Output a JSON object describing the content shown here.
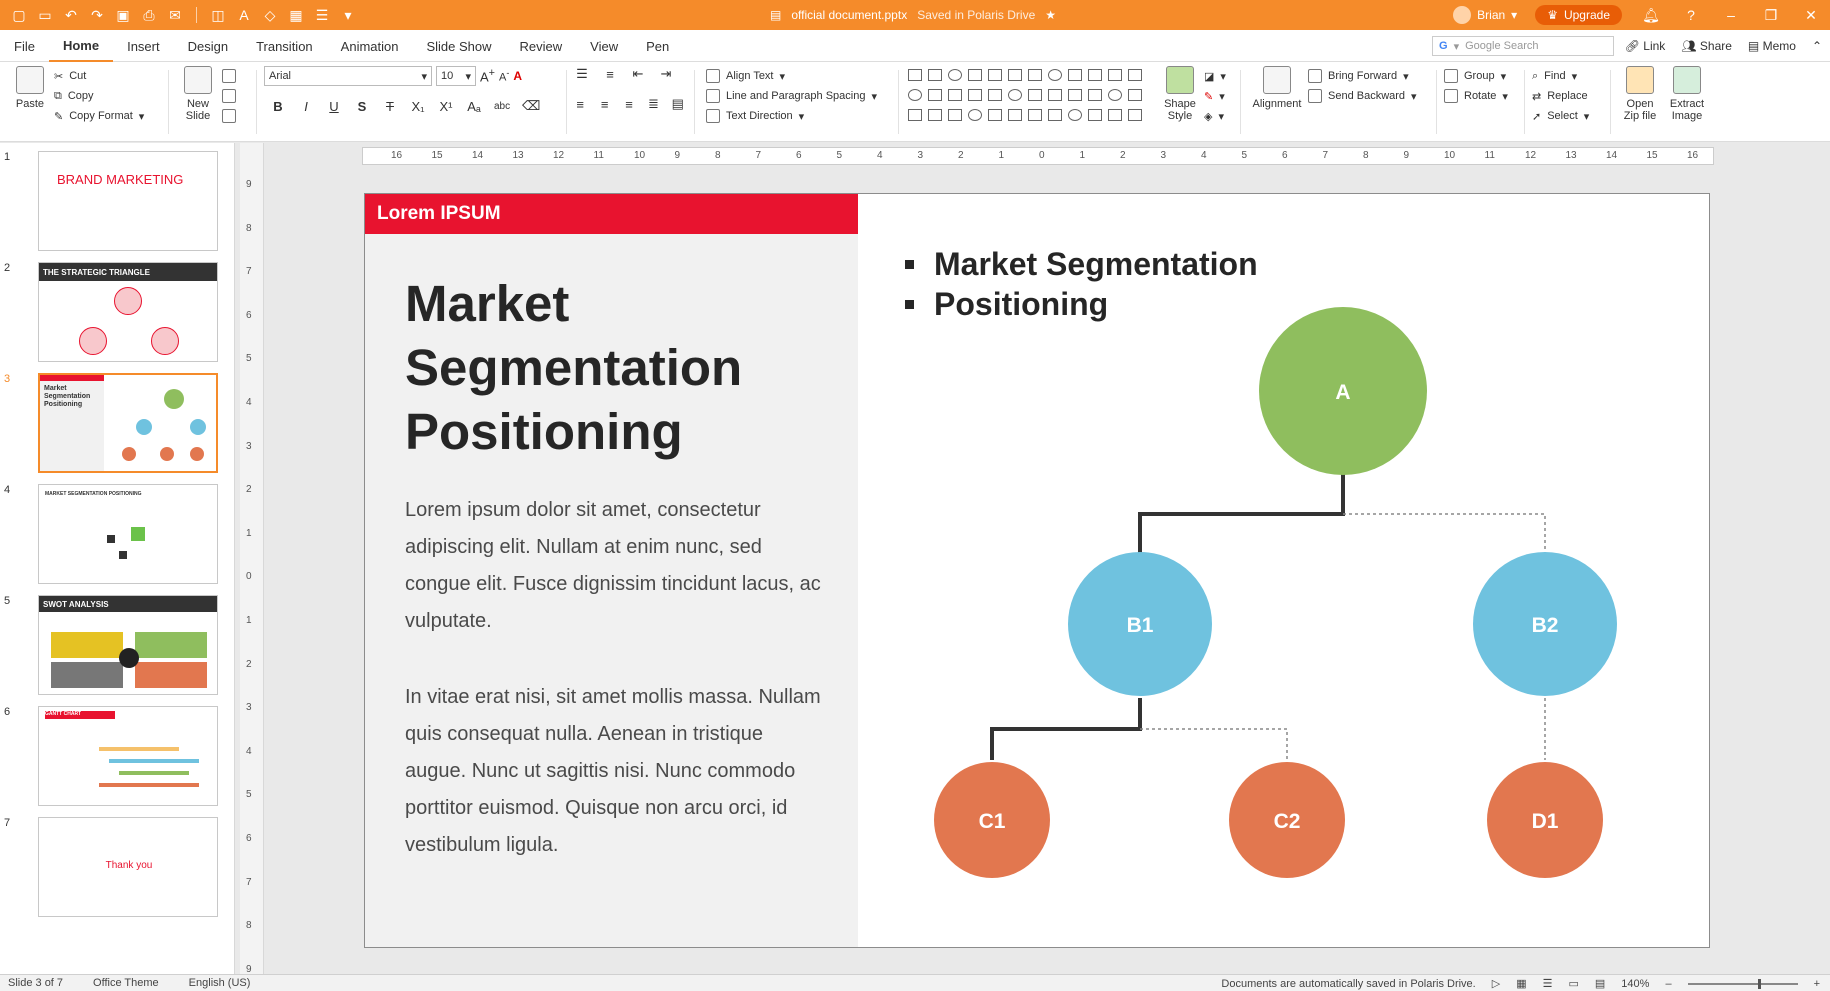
{
  "titlebar": {
    "doc_name": "official document.pptx",
    "saved_status": "Saved in Polaris Drive",
    "user_name": "Brian",
    "upgrade_label": "Upgrade"
  },
  "menu": {
    "items": [
      "File",
      "Home",
      "Insert",
      "Design",
      "Transition",
      "Animation",
      "Slide Show",
      "Review",
      "View",
      "Pen"
    ],
    "active": "Home",
    "search_placeholder": "Google Search",
    "right": [
      "Link",
      "Share",
      "Memo"
    ]
  },
  "ribbon": {
    "paste": "Paste",
    "cut": "Cut",
    "copy": "Copy",
    "copy_format": "Copy Format",
    "new_slide": "New Slide",
    "font_name": "Arial",
    "font_size": "10",
    "align_text": "Align Text",
    "line_spacing": "Line and Paragraph Spacing",
    "text_direction": "Text Direction",
    "shape_style": "Shape Style",
    "alignment": "Alignment",
    "bring_forward": "Bring Forward",
    "send_backward": "Send Backward",
    "group": "Group",
    "rotate": "Rotate",
    "find": "Find",
    "replace": "Replace",
    "select": "Select",
    "open_zip": "Open Zip file",
    "extract_image": "Extract Image"
  },
  "thumbnails": [
    {
      "num": "1",
      "title": "BRAND MARKETING"
    },
    {
      "num": "2",
      "title": "THE STRATEGIC TRIANGLE"
    },
    {
      "num": "3",
      "title": "Market Segmentation Positioning"
    },
    {
      "num": "4",
      "title": "MARKET SEGMENTATION POSITIONING"
    },
    {
      "num": "5",
      "title": "SWOT ANALYSIS"
    },
    {
      "num": "6",
      "title": "GANTT CHART"
    },
    {
      "num": "7",
      "title": "Thank you"
    }
  ],
  "slide": {
    "header": "Lorem IPSUM",
    "title_lines": [
      "Market",
      "Segmentation",
      "Positioning"
    ],
    "body1": "Lorem ipsum dolor sit amet, consectetur adipiscing elit. Nullam at enim nunc, sed congue elit. Fusce dignissim tincidunt lacus, ac vulputate.",
    "body2": "In vitae erat nisi, sit amet mollis massa. Nullam quis consequat nulla. Aenean in tristique augue. Nunc ut sagittis nisi. Nunc commodo porttitor euismod. Quisque non arcu orci, id vestibulum ligula.",
    "bullets": [
      "Market Segmentation",
      "Positioning"
    ],
    "nodes": {
      "a": "A",
      "b1": "B1",
      "b2": "B2",
      "c1": "C1",
      "c2": "C2",
      "d1": "D1"
    },
    "colors": {
      "green": "#8fbe5e",
      "blue": "#6fc2df",
      "orange": "#e2774f",
      "red": "#e8132f"
    }
  },
  "status": {
    "slide": "Slide 3 of 7",
    "theme": "Office Theme",
    "language": "English (US)",
    "autosave": "Documents are automatically saved in Polaris Drive.",
    "zoom": "140%"
  },
  "rulers": {
    "horizontal": [
      "16",
      "15",
      "14",
      "13",
      "12",
      "11",
      "10",
      "9",
      "8",
      "7",
      "6",
      "5",
      "4",
      "3",
      "2",
      "1",
      "0",
      "1",
      "2",
      "3",
      "4",
      "5",
      "6",
      "7",
      "8",
      "9",
      "10",
      "11",
      "12",
      "13",
      "14",
      "15",
      "16"
    ],
    "vertical": [
      "9",
      "8",
      "7",
      "6",
      "5",
      "4",
      "3",
      "2",
      "1",
      "0",
      "1",
      "2",
      "3",
      "4",
      "5",
      "6",
      "7",
      "8",
      "9"
    ]
  }
}
